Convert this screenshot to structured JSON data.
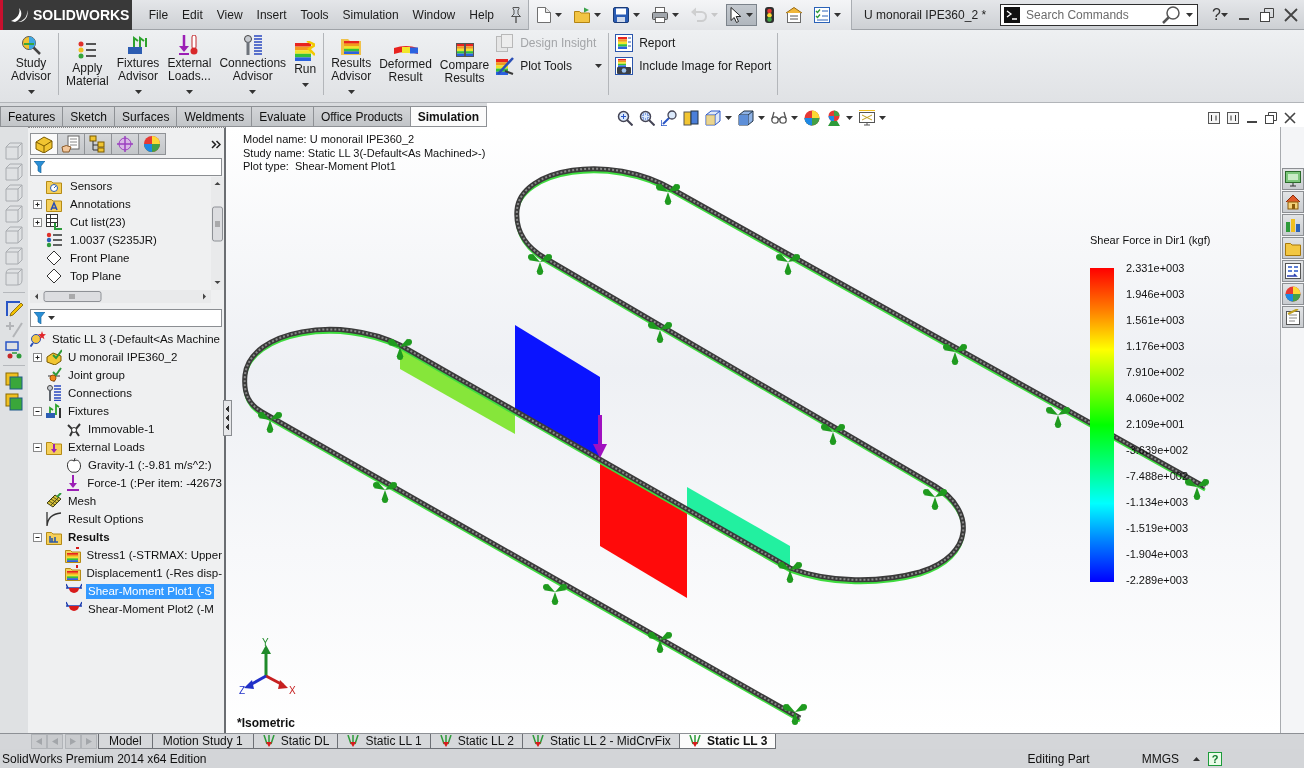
{
  "title_bar": {
    "logo": "SOLIDWORKS",
    "menu": [
      "File",
      "Edit",
      "View",
      "Insert",
      "Tools",
      "Simulation",
      "Window",
      "Help"
    ],
    "quick_access": [
      {
        "dropdown": true,
        "disabled": false,
        "pressed": false
      },
      {
        "dropdown": true,
        "disabled": false,
        "pressed": false
      },
      {
        "dropdown": true,
        "disabled": false,
        "pressed": false
      },
      {
        "dropdown": true,
        "disabled": false,
        "pressed": false
      },
      {
        "dropdown": true,
        "disabled": true,
        "pressed": false
      },
      {
        "dropdown": true,
        "disabled": false,
        "pressed": true
      },
      {
        "dropdown": false,
        "disabled": false,
        "pressed": false
      },
      {
        "dropdown": false,
        "disabled": false,
        "pressed": false
      },
      {
        "dropdown": true,
        "disabled": false,
        "pressed": false
      }
    ],
    "document_title": "U monorail IPE360_2 *",
    "search": {
      "placeholder": "Search Commands"
    },
    "help": "?"
  },
  "ribbon": [
    {
      "items": [
        {
          "kind": "large",
          "label": "Study Advisor",
          "dropdown": true,
          "disabled": false
        }
      ]
    },
    {
      "items": [
        {
          "kind": "large",
          "label": "Apply Material",
          "dropdown": false,
          "disabled": false
        },
        {
          "kind": "large",
          "label": "Fixtures Advisor",
          "dropdown": true,
          "disabled": false
        },
        {
          "kind": "large",
          "label": "External Loads...",
          "dropdown": true,
          "disabled": false
        },
        {
          "kind": "large",
          "label": "Connections Advisor",
          "dropdown": true,
          "disabled": false
        },
        {
          "kind": "large",
          "label": "Run",
          "dropdown": true,
          "disabled": false
        }
      ]
    },
    {
      "items": [
        {
          "kind": "large",
          "label": "Results Advisor",
          "dropdown": true,
          "disabled": false
        },
        {
          "kind": "large",
          "label": "Deformed Result",
          "dropdown": false,
          "disabled": false
        },
        {
          "kind": "large",
          "label": "Compare Results",
          "dropdown": false,
          "disabled": false
        },
        {
          "kind": "small",
          "label": "Design Insight",
          "dropdown": false,
          "disabled": true
        },
        {
          "kind": "small",
          "label": "Plot Tools",
          "dropdown": true,
          "disabled": false
        }
      ]
    },
    {
      "items": [
        {
          "kind": "small",
          "label": "Report",
          "dropdown": false,
          "disabled": false
        },
        {
          "kind": "small",
          "label": "Include Image for Report",
          "dropdown": false,
          "disabled": false
        }
      ]
    }
  ],
  "command_tabs": [
    {
      "label": "Features",
      "selected": false
    },
    {
      "label": "Sketch",
      "selected": false
    },
    {
      "label": "Surfaces",
      "selected": false
    },
    {
      "label": "Weldments",
      "selected": false
    },
    {
      "label": "Evaluate",
      "selected": false
    },
    {
      "label": "Office Products",
      "selected": false
    },
    {
      "label": "Simulation",
      "selected": true
    }
  ],
  "left_toolbar": [
    {
      "disabled": true
    },
    {
      "disabled": true
    },
    {
      "disabled": true
    },
    {
      "disabled": true
    },
    {
      "disabled": true
    },
    {
      "disabled": true
    },
    {
      "disabled": true
    },
    {
      "disabled": false
    },
    {
      "disabled": true
    },
    {
      "disabled": false
    },
    {
      "disabled": false
    },
    {
      "disabled": false
    }
  ],
  "feature_manager": {
    "tabs": [
      {
        "selected": true
      },
      {
        "selected": false
      },
      {
        "selected": false
      },
      {
        "selected": false
      },
      {
        "selected": false
      }
    ],
    "upper_tree": [
      {
        "label": "Sensors",
        "selected": false
      },
      {
        "label": "Annotations",
        "expanded": false,
        "selected": false
      },
      {
        "label": "Cut list(23)",
        "expanded": false,
        "selected": false
      },
      {
        "label": "1.0037 (S235JR)",
        "selected": false
      },
      {
        "label": "Front Plane",
        "selected": false
      },
      {
        "label": "Top Plane",
        "selected": false
      }
    ],
    "study_tree": [
      {
        "label": "Static LL 3 (-Default<As Machine",
        "selected": false,
        "children": [
          {
            "label": "U monorail IPE360_2",
            "expanded": false,
            "selected": false
          },
          {
            "label": "Joint group",
            "selected": false
          },
          {
            "label": "Connections",
            "selected": false
          },
          {
            "label": "Fixtures",
            "expanded": true,
            "selected": false,
            "children": [
              {
                "label": "Immovable-1",
                "selected": false
              }
            ]
          },
          {
            "label": "External Loads",
            "expanded": true,
            "selected": false,
            "children": [
              {
                "label": "Gravity-1 (:-9.81 m/s^2:)",
                "selected": false
              },
              {
                "label": "Force-1 (:Per item: -42673",
                "selected": false
              }
            ]
          },
          {
            "label": "Mesh",
            "selected": false
          },
          {
            "label": "Result Options",
            "selected": false
          },
          {
            "label": "Results",
            "bold": true,
            "expanded": true,
            "selected": false,
            "children": [
              {
                "label": "Stress1 (-STRMAX: Upper",
                "selected": false
              },
              {
                "label": "Displacement1 (-Res disp-",
                "selected": false
              },
              {
                "label": "Shear-Moment Plot1 (-S",
                "selected": true
              },
              {
                "label": "Shear-Moment Plot2 (-M",
                "selected": false
              }
            ]
          }
        ]
      }
    ]
  },
  "viewport": {
    "info": [
      "Model name: U monorail IPE360_2",
      "Study name: Static LL 3(-Default<As Machined>-)",
      "Plot type:  Shear-Moment Plot1"
    ],
    "legend": {
      "title": "Shear Force in Dir1 (kgf)",
      "labels": [
        "2.331e+003",
        "1.946e+003",
        "1.561e+003",
        "1.176e+003",
        "7.910e+002",
        "4.060e+002",
        "2.109e+001",
        "-3.639e+002",
        "-7.488e+002",
        "-1.134e+003",
        "-1.519e+003",
        "-1.904e+003",
        "-2.289e+003"
      ]
    },
    "axes": [
      "Y",
      "Z",
      "X"
    ],
    "view_name": "*Isometric"
  },
  "study_tab_scroll": [
    {
      "disabled": true
    },
    {
      "disabled": true
    },
    {
      "disabled": true
    },
    {
      "disabled": true
    }
  ],
  "study_tabs": [
    {
      "kind": "model",
      "label": "Model",
      "selected": false
    },
    {
      "kind": "motion",
      "label": "Motion Study 1",
      "selected": false
    },
    {
      "kind": "static",
      "label": "Static DL",
      "selected": false
    },
    {
      "kind": "static",
      "label": "Static LL 1",
      "selected": false
    },
    {
      "kind": "static",
      "label": "Static LL 2",
      "selected": false
    },
    {
      "kind": "static",
      "label": "Static LL 2 - MidCrvFix",
      "selected": false
    },
    {
      "kind": "static",
      "label": "Static LL 3",
      "selected": true
    }
  ],
  "status_bar": {
    "edition": "SolidWorks Premium 2014 x64 Edition",
    "mode": "Editing Part",
    "units": "MMGS",
    "help": "?"
  }
}
